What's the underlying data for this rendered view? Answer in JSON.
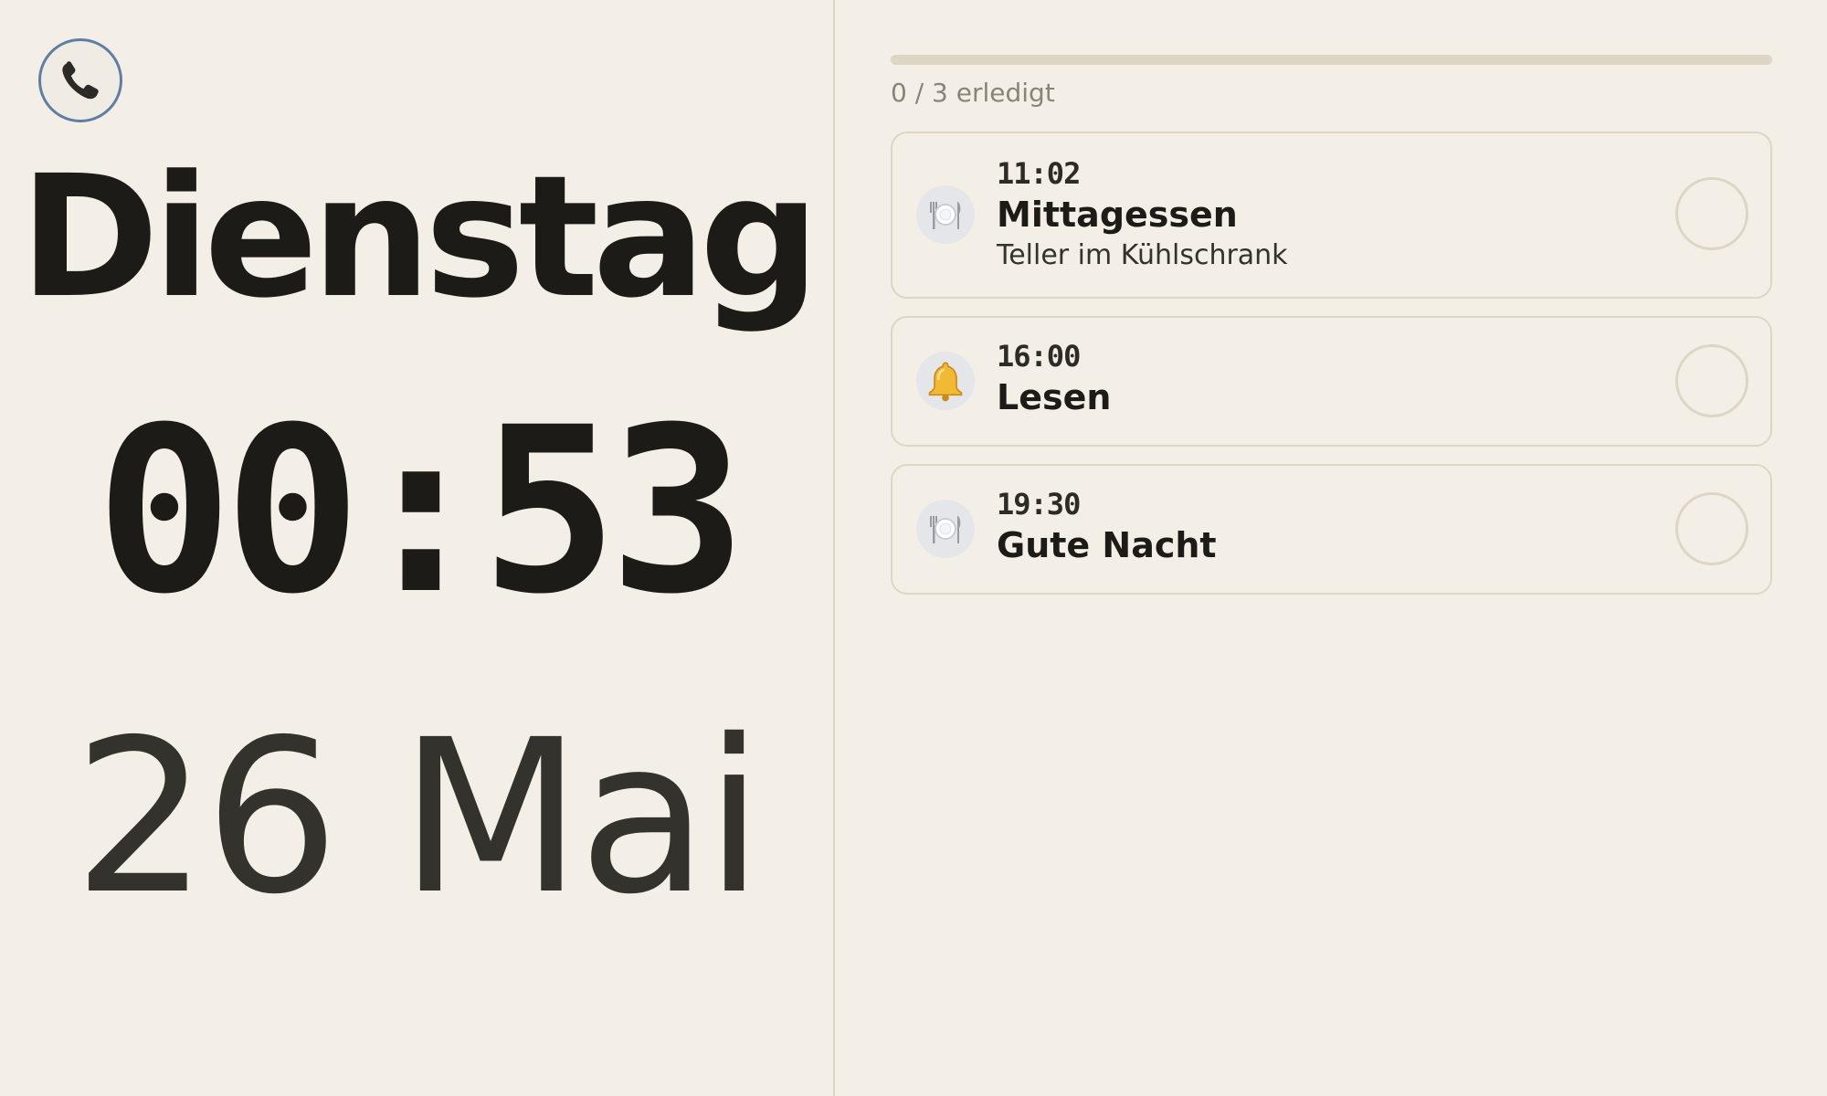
{
  "header": {
    "call_button": {
      "icon": "phone-icon"
    }
  },
  "clock": {
    "weekday": "Dienstag",
    "time": "00:53",
    "date": "26 Mai"
  },
  "progress": {
    "label": "0 / 3 erledigt",
    "done": 0,
    "total": 3,
    "fraction": 0
  },
  "tasks": [
    {
      "time": "11:02",
      "title": "Mittagessen",
      "note": "Teller im Kühlschrank",
      "icon": "plate-icon",
      "done": false
    },
    {
      "time": "16:00",
      "title": "Lesen",
      "note": "",
      "icon": "bell-icon",
      "done": false
    },
    {
      "time": "19:30",
      "title": "Gute Nacht",
      "note": "",
      "icon": "plate-icon",
      "done": false
    }
  ],
  "colors": {
    "background": "#f3efe6",
    "text": "#1d1b17",
    "border": "#ddd6c5",
    "call_ring": "#5d7ea5"
  }
}
